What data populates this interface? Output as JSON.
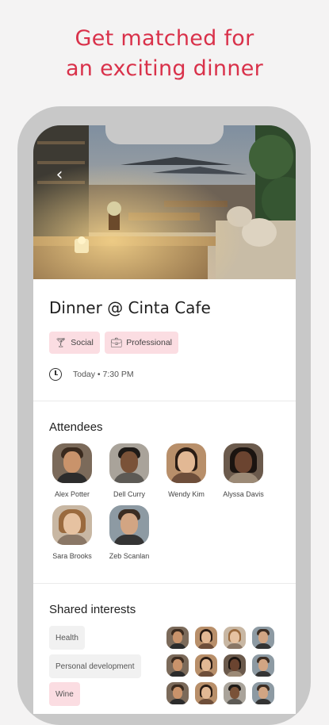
{
  "headline": {
    "line1": "Get matched for",
    "line2": "an exciting dinner"
  },
  "event": {
    "back_icon": "chevron-left-icon",
    "title": "Dinner @ Cinta Cafe",
    "chips": [
      {
        "icon": "cocktail-icon",
        "label": "Social"
      },
      {
        "icon": "briefcase-icon",
        "label": "Professional"
      }
    ],
    "time_icon": "clock-icon",
    "time": "Today • 7:30 PM"
  },
  "attendees": {
    "title": "Attendees",
    "people": [
      {
        "name": "Alex Potter"
      },
      {
        "name": "Dell Curry"
      },
      {
        "name": "Wendy Kim"
      },
      {
        "name": "Alyssa Davis"
      },
      {
        "name": "Sara Brooks"
      },
      {
        "name": "Zeb Scanlan"
      }
    ]
  },
  "interests": {
    "title": "Shared interests",
    "tags": [
      "Health",
      "Personal development",
      "Wine"
    ]
  },
  "colors": {
    "accent": "#d9314a",
    "chip_bg": "#fbdde2",
    "phone_frame": "#c8c8c8"
  }
}
